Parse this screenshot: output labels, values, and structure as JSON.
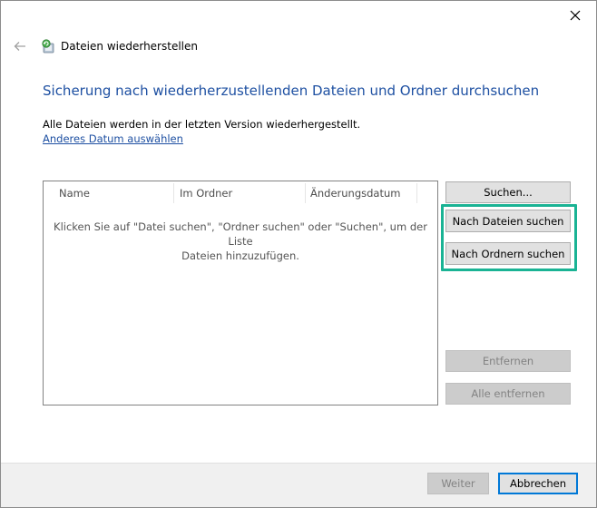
{
  "window": {
    "title": "Dateien wiederherstellen"
  },
  "main": {
    "heading": "Sicherung nach wiederherzustellenden Dateien und Ordner durchsuchen",
    "info": "Alle Dateien werden in der letzten Version wiederhergestellt.",
    "change_date_link": "Anderes Datum auswählen"
  },
  "list": {
    "columns": [
      "Name",
      "Im Ordner",
      "Änderungsdatum"
    ],
    "empty_message_line1": "Klicken Sie auf \"Datei suchen\", \"Ordner suchen\" oder \"Suchen\", um der Liste",
    "empty_message_line2": "Dateien hinzuzufügen."
  },
  "buttons": {
    "search": "Suchen...",
    "search_files": "Nach Dateien suchen",
    "search_folders": "Nach Ordnern suchen",
    "remove": "Entfernen",
    "remove_all": "Alle entfernen",
    "next": "Weiter",
    "cancel": "Abbrechen"
  },
  "colors": {
    "heading": "#1e50a2",
    "highlight": "#1ab394",
    "button": "#e1e1e1",
    "button_disabled": "#cccccc"
  },
  "icons": {
    "close": "close-icon",
    "back": "back-arrow-icon",
    "app": "restore-files-icon"
  }
}
